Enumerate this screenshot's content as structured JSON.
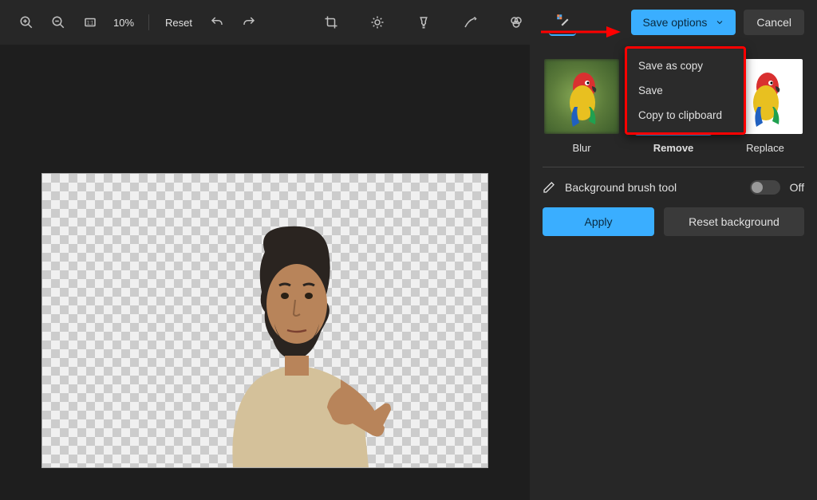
{
  "toolbar": {
    "zoom_level": "10%",
    "reset_label": "Reset",
    "save_options_label": "Save options",
    "cancel_label": "Cancel",
    "icons": {
      "zoom_in": "zoom-in-icon",
      "zoom_out": "zoom-out-icon",
      "fit": "fit-screen-icon",
      "undo": "undo-icon",
      "redo": "redo-icon",
      "crop": "crop-icon",
      "adjust": "adjustment-icon",
      "filter": "filter-icon",
      "markup": "markup-icon",
      "retouch": "retouch-icon",
      "erase_bg": "background-erase-icon"
    }
  },
  "dropdown": {
    "items": [
      {
        "label": "Save as copy"
      },
      {
        "label": "Save"
      },
      {
        "label": "Copy to clipboard"
      }
    ]
  },
  "panel": {
    "options": [
      {
        "label": "Blur",
        "selected": false,
        "bg_type": "blur"
      },
      {
        "label": "Remove",
        "selected": true,
        "bg_type": "checker"
      },
      {
        "label": "Replace",
        "selected": false,
        "bg_type": "white"
      }
    ],
    "brush_tool_label": "Background brush tool",
    "brush_toggle_state": "Off",
    "apply_label": "Apply",
    "reset_bg_label": "Reset background"
  },
  "colors": {
    "accent": "#3aaeff",
    "annotation": "#ff0000"
  }
}
